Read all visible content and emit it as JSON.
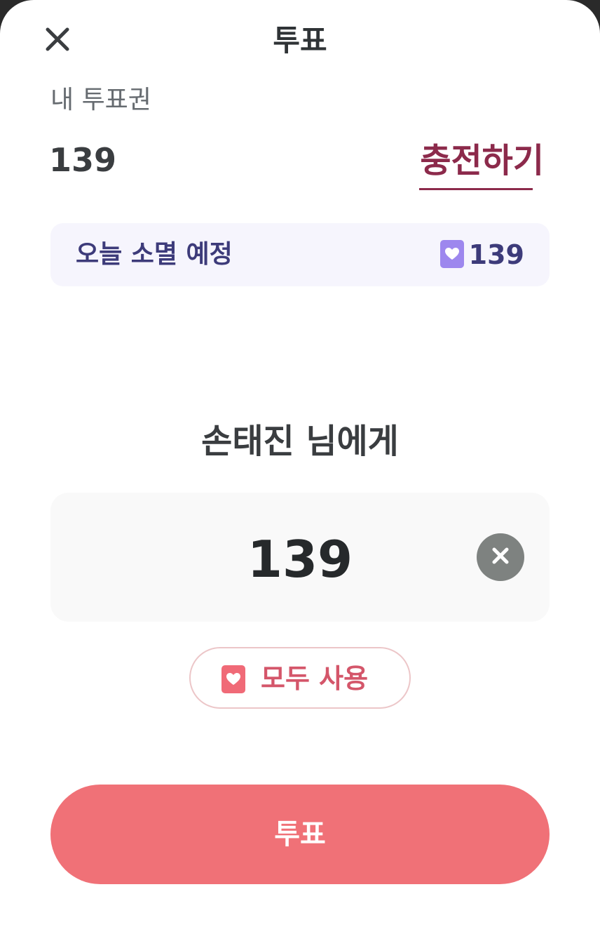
{
  "header": {
    "title": "투표",
    "close_icon": "close-icon"
  },
  "my_votes": {
    "label": "내 투표권",
    "value": "139",
    "charge_label": "충전하기"
  },
  "expiring": {
    "label": "오늘 소멸 예정",
    "icon": "heart-ticket-icon",
    "value": "139"
  },
  "vote": {
    "recipient_text": "손태진 님에게",
    "amount": "139",
    "clear_icon": "clear-icon",
    "use_all_label": "모두 사용",
    "use_all_icon": "heart-ticket-icon",
    "submit_label": "투표"
  },
  "colors": {
    "accent": "#f07177",
    "charge": "#8c2a4b",
    "expire_text": "#3d3b7a",
    "expire_bg": "#f6f5fd",
    "ticket_purple": "#9d87ee",
    "ticket_red": "#f06a77"
  }
}
